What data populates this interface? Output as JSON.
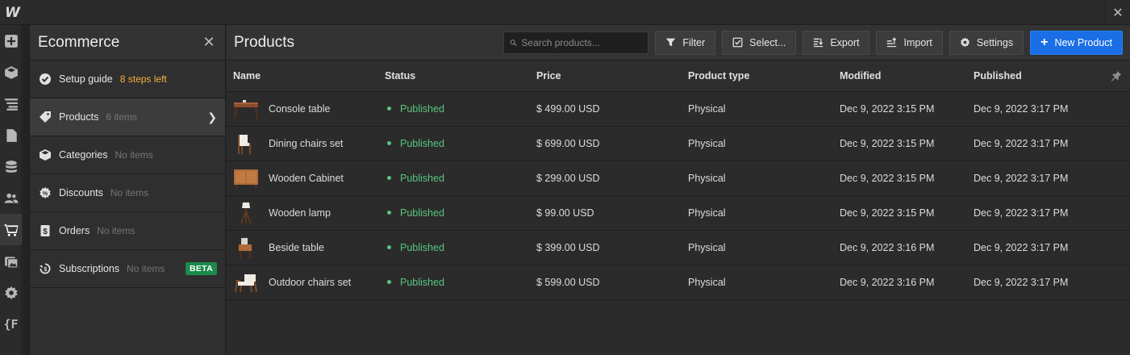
{
  "app": {
    "logo": "W",
    "close_icon": "close-icon"
  },
  "rail": {
    "items": [
      {
        "name": "add-icon",
        "active": false
      },
      {
        "name": "box-icon",
        "active": false
      },
      {
        "name": "navigator-icon",
        "active": false
      },
      {
        "name": "pages-icon",
        "active": false
      },
      {
        "name": "cms-icon",
        "active": false
      },
      {
        "name": "users-icon",
        "active": false
      },
      {
        "name": "cart-icon",
        "active": true
      },
      {
        "name": "assets-icon",
        "active": false
      },
      {
        "name": "settings-icon",
        "active": false
      },
      {
        "name": "logic-icon",
        "active": false
      }
    ]
  },
  "panel": {
    "title": "Ecommerce",
    "items": [
      {
        "label": "Setup guide",
        "sub": "8 steps left",
        "icon": "check-circle-icon"
      },
      {
        "label": "Products",
        "sub": "6 items",
        "icon": "tag-icon"
      },
      {
        "label": "Categories",
        "sub": "No items",
        "icon": "cube-icon"
      },
      {
        "label": "Discounts",
        "sub": "No items",
        "icon": "discount-icon"
      },
      {
        "label": "Orders",
        "sub": "No items",
        "icon": "dollar-doc-icon"
      },
      {
        "label": "Subscriptions",
        "sub": "No items",
        "icon": "subscription-icon",
        "badge": "BETA"
      }
    ]
  },
  "main": {
    "title": "Products",
    "search": {
      "placeholder": "Search products..."
    },
    "toolbar": {
      "filter": "Filter",
      "select": "Select...",
      "export": "Export",
      "import": "Import",
      "settings": "Settings",
      "new_product": "New Product"
    },
    "columns": [
      "Name",
      "Status",
      "Price",
      "Product type",
      "Modified",
      "Published"
    ],
    "rows": [
      {
        "name": "Console table",
        "status": "Published",
        "price": "$ 499.00 USD",
        "type": "Physical",
        "modified": "Dec 9, 2022 3:15 PM",
        "published": "Dec 9, 2022 3:17 PM",
        "thumb": "console"
      },
      {
        "name": "Dining chairs set",
        "status": "Published",
        "price": "$ 699.00 USD",
        "type": "Physical",
        "modified": "Dec 9, 2022 3:15 PM",
        "published": "Dec 9, 2022 3:17 PM",
        "thumb": "chair"
      },
      {
        "name": "Wooden Cabinet",
        "status": "Published",
        "price": "$ 299.00 USD",
        "type": "Physical",
        "modified": "Dec 9, 2022 3:15 PM",
        "published": "Dec 9, 2022 3:17 PM",
        "thumb": "cabinet"
      },
      {
        "name": "Wooden lamp",
        "status": "Published",
        "price": "$ 99.00 USD",
        "type": "Physical",
        "modified": "Dec 9, 2022 3:15 PM",
        "published": "Dec 9, 2022 3:17 PM",
        "thumb": "lamp"
      },
      {
        "name": "Beside table",
        "status": "Published",
        "price": "$ 399.00 USD",
        "type": "Physical",
        "modified": "Dec 9, 2022 3:16 PM",
        "published": "Dec 9, 2022 3:17 PM",
        "thumb": "side"
      },
      {
        "name": "Outdoor chairs set",
        "status": "Published",
        "price": "$ 599.00 USD",
        "type": "Physical",
        "modified": "Dec 9, 2022 3:16 PM",
        "published": "Dec 9, 2022 3:17 PM",
        "thumb": "outdoor"
      }
    ]
  },
  "colors": {
    "accent": "#1a6ee6",
    "published": "#5ac47f",
    "warn": "#f2b23a",
    "beta": "#1b8a4b"
  }
}
